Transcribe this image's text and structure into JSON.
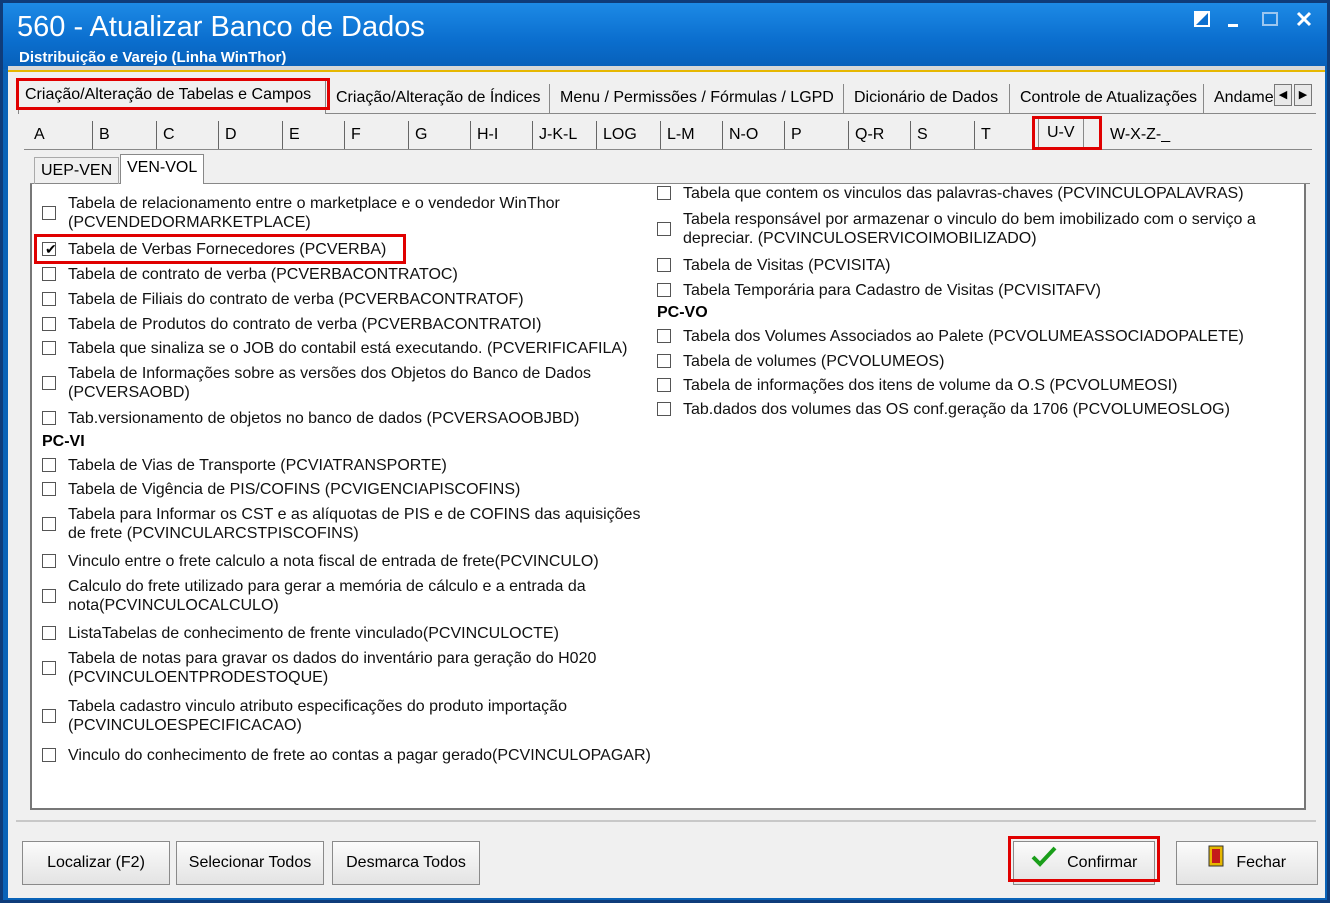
{
  "window": {
    "title": "560 - Atualizar Banco de Dados",
    "subtitle": "Distribuição e Varejo (Linha WinThor)",
    "controls": [
      "restore",
      "minimize",
      "maximize",
      "close"
    ]
  },
  "main_tabs": [
    "Criação/Alteração de Tabelas e Campos",
    "Criação/Alteração de Índices",
    "Menu / Permissões / Fórmulas / LGPD",
    "Dicionário de Dados",
    "Controle de Atualizações",
    "Andame"
  ],
  "letter_tabs": [
    "A",
    "B",
    "C",
    "D",
    "E",
    "F",
    "G",
    "H-I",
    "J-K-L",
    "LOG",
    "L-M",
    "N-O",
    "P",
    "Q-R",
    "S",
    "T",
    "U-V",
    "W-X-Z-_"
  ],
  "sub_tabs": [
    "UEP-VEN",
    "VEN-VOL"
  ],
  "left_column": [
    {
      "label": "Tabela de relacionamento entre o marketplace e o vendedor WinThor",
      "label2": "(PCVENDEDORMARKETPLACE)",
      "checked": false
    },
    {
      "label": "Tabela de Verbas Fornecedores (PCVERBA)",
      "checked": true
    },
    {
      "label": "Tabela de contrato de verba (PCVERBACONTRATOC)",
      "checked": false
    },
    {
      "label": "Tabela de Filiais do contrato de verba (PCVERBACONTRATOF)",
      "checked": false
    },
    {
      "label": "Tabela de Produtos do contrato de verba (PCVERBACONTRATOI)",
      "checked": false
    },
    {
      "label": "Tabela que sinaliza se o JOB do contabil está executando. (PCVERIFICAFILA)",
      "checked": false
    },
    {
      "label": "Tabela de Informações sobre as versões dos Objetos do Banco de Dados",
      "label2": "(PCVERSAOBD)",
      "checked": false
    },
    {
      "label": "Tab.versionamento de objetos no banco de dados (PCVERSAOOBJBD)",
      "checked": false
    }
  ],
  "section_pcvi": "PC-VI",
  "left_column_vi": [
    {
      "label": "Tabela de Vias de Transporte (PCVIATRANSPORTE)",
      "checked": false
    },
    {
      "label": "Tabela de Vigência de PIS/COFINS (PCVIGENCIAPISCOFINS)",
      "checked": false
    },
    {
      "label": "Tabela para Informar os CST e as alíquotas de PIS e de COFINS das aquisições",
      "label2": "de frete (PCVINCULARCSTPISCOFINS)",
      "checked": false
    },
    {
      "label": "Vinculo entre o frete calculo a nota fiscal de entrada de frete(PCVINCULO)",
      "checked": false
    },
    {
      "label": "Calculo do frete utilizado para gerar a memória de cálculo e a entrada da",
      "label2": "nota(PCVINCULOCALCULO)",
      "checked": false
    },
    {
      "label": "ListaTabelas de conhecimento de frente vinculado(PCVINCULOCTE)",
      "checked": false
    },
    {
      "label": "Tabela de notas  para gravar os dados do inventário para geração do H020",
      "label2": "(PCVINCULOENTPRODESTOQUE)",
      "checked": false
    },
    {
      "label": "Tabela cadastro vinculo atributo especificações do produto importação",
      "label2": "(PCVINCULOESPECIFICACAO)",
      "checked": false
    },
    {
      "label": "Vinculo do conhecimento de frete ao contas a pagar gerado(PCVINCULOPAGAR)",
      "checked": false
    }
  ],
  "right_column": [
    {
      "label": "Tabela que contem os vinculos das palavras-chaves (PCVINCULOPALAVRAS)",
      "checked": false
    },
    {
      "label": "Tabela responsável por armazenar o vinculo do bem imobilizado com o serviço a",
      "label2": "depreciar. (PCVINCULOSERVICOIMOBILIZADO)",
      "checked": false
    },
    {
      "label": "Tabela  de Visitas (PCVISITA)",
      "checked": false
    },
    {
      "label": "Tabela Temporária para Cadastro de Visitas (PCVISITAFV)",
      "checked": false
    }
  ],
  "section_pcvo": "PC-VO",
  "right_column_vo": [
    {
      "label": "Tabela dos Volumes Associados ao Palete (PCVOLUMEASSOCIADOPALETE)",
      "checked": false
    },
    {
      "label": "Tabela de volumes (PCVOLUMEOS)",
      "checked": false
    },
    {
      "label": "Tabela de informações dos itens de volume da O.S (PCVOLUMEOSI)",
      "checked": false
    },
    {
      "label": "Tab.dados dos volumes das OS conf.geração da 1706 (PCVOLUMEOSLOG)",
      "checked": false
    }
  ],
  "buttons": {
    "localizar": "Localizar (F2)",
    "selecionar": "Selecionar Todos",
    "desmarca": "Desmarca Todos",
    "confirmar": "Confirmar",
    "fechar": "Fechar"
  },
  "colors": {
    "highlight": "#e00000",
    "title_bg": "#0b6fcf",
    "confirm_check": "#1a9e1a"
  }
}
